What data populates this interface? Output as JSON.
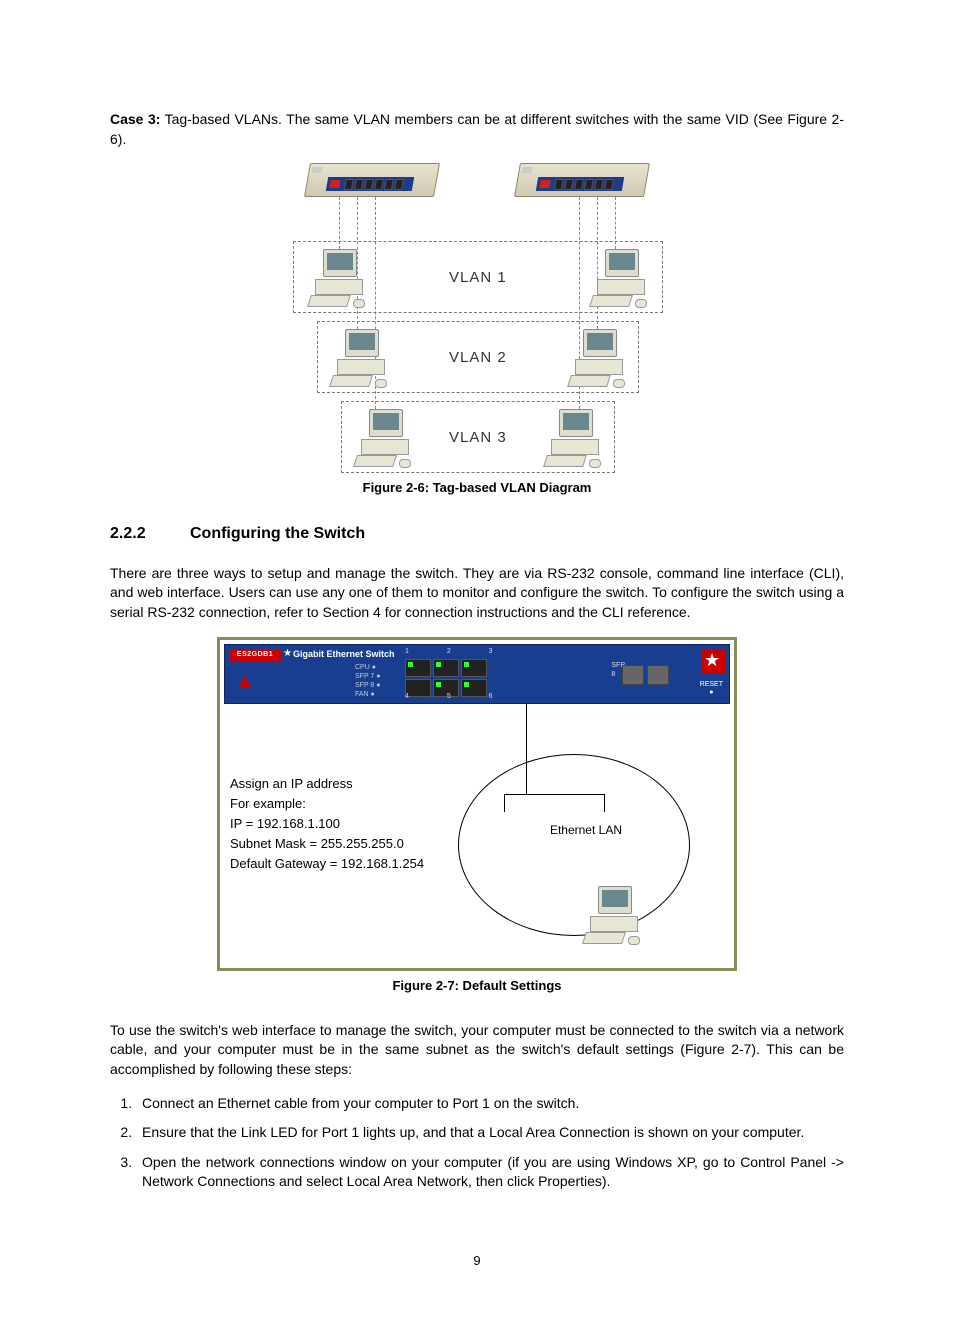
{
  "intro": {
    "case_label": "Case 3:",
    "case_text": " Tag-based VLANs. The same VLAN members can be at different switches with the same VID (See Figure 2-6)."
  },
  "fig26": {
    "vlan1": "VLAN 1",
    "vlan2": "VLAN 2",
    "vlan3": "VLAN 3",
    "caption": "Figure 2-6: Tag-based VLAN Diagram"
  },
  "section": {
    "number": "2.2.2",
    "title": "Configuring the Switch",
    "para1": "There are three ways to setup and manage the switch. They are via RS-232 console, command line interface (CLI), and web interface. Users can use any one of them to monitor and configure the switch. To configure the switch using a serial RS-232 connection, refer to Section 4 for connection instructions and the CLI reference."
  },
  "fig27": {
    "switch": {
      "brand": "ES2GDB1",
      "title": "Gigabit Ethernet Switch",
      "leds": "CPU ●\nSFP 7 ●\nSFP 8 ●\nFAN ●",
      "sfp": "SFP",
      "sfpnum": "8",
      "reset": "RESET\n●",
      "portnums_top": "1 2 3",
      "portnums_bot": "4 5 6"
    },
    "assign_lines": [
      "Assign an IP address",
      "For example:",
      "IP = 192.168.1.100",
      "Subnet Mask = 255.255.255.0",
      "Default Gateway = 192.168.1.254"
    ],
    "eth_label": "Ethernet LAN",
    "caption": "Figure 2-7: Default Settings"
  },
  "para2": "To use the switch's web interface to manage the switch, your computer must be connected to the switch via a network cable, and your computer must be in the same subnet as the switch's default settings (Figure 2-7). This can be accomplished by following these steps:",
  "steps": [
    "Connect an Ethernet cable from your computer to Port 1 on the switch.",
    "Ensure that the Link LED for Port 1 lights up, and that a Local Area Connection is shown on your computer.",
    "Open the network connections window on your computer (if you are using Windows XP, go to Control Panel -> Network Connections and select Local Area Network, then click Properties)."
  ],
  "page_number": "9"
}
